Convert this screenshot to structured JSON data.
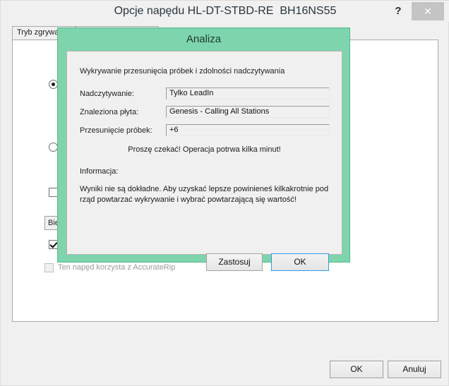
{
  "window": {
    "title": "Opcje napędu HL-DT-STBD-RE  BH16NS55",
    "help_label": "?",
    "close_label": "✕",
    "tabs": [
      {
        "label": "Tryb zgrywania"
      },
      {
        "label": ""
      }
    ],
    "background_controls": {
      "radio_1_label": "",
      "radio_2_label": "",
      "checkbox_1_label": "",
      "button_1_label": "Bie",
      "checkbox_2_label": "",
      "accuraterip_label": "Ten napęd korzysta z AccurateRip"
    },
    "buttons": {
      "ok": "OK",
      "cancel": "Anuluj"
    }
  },
  "dialog": {
    "title": "Analiza",
    "heading": "Wykrywanie przesunięcia próbek i zdolności nadczytywania",
    "fields": [
      {
        "label": "Nadczytywanie:",
        "value": "Tylko LeadIn"
      },
      {
        "label": "Znaleziona płyta:",
        "value": "Genesis - Calling All Stations"
      },
      {
        "label": "Przesunięcie próbek:",
        "value": "+6"
      }
    ],
    "wait_message": "Proszę czekać! Operacja potrwa kilka minut!",
    "info_label": "Informacja:",
    "info_text": "Wyniki nie są dokładne. Aby uzyskać lepsze powinieneś kilkakrotnie pod rząd powtarzać wykrywanie i wybrać powtarzającą się wartość!",
    "buttons": {
      "apply": "Zastosuj",
      "ok": "OK"
    },
    "colors": {
      "frame": "#7ed4ad",
      "body": "#f0f0f0",
      "focus_ring": "#3399e6"
    }
  }
}
